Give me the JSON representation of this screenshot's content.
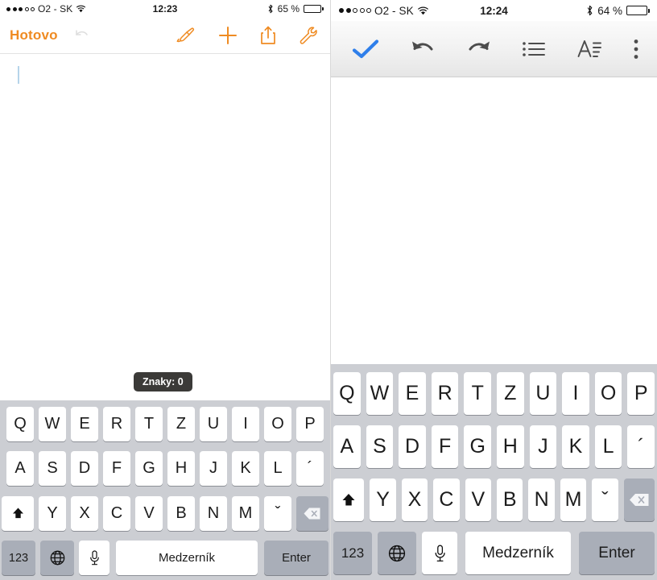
{
  "left": {
    "status": {
      "signal_filled": 3,
      "signal_total": 5,
      "carrier": "O2 - SK",
      "wifi_icon": "wifi-icon",
      "time": "12:23",
      "bluetooth_icon": "bluetooth-icon",
      "battery_text": "65 %",
      "battery_percent": 65
    },
    "toolbar": {
      "done_label": "Hotovo",
      "undo_icon": "undo-icon",
      "undo_disabled": true,
      "icons": [
        "brush-icon",
        "plus-icon",
        "share-icon",
        "wrench-icon"
      ],
      "accent_color": "#ef8b22"
    },
    "note": {
      "body_text": "",
      "caret_visible": true
    },
    "tooltip": {
      "text": "Znaky: 0"
    },
    "keyboard": {
      "row1": [
        "Q",
        "W",
        "E",
        "R",
        "T",
        "Z",
        "U",
        "I",
        "O",
        "P"
      ],
      "row2": [
        "A",
        "S",
        "D",
        "F",
        "G",
        "H",
        "J",
        "K",
        "L",
        "´"
      ],
      "row3": [
        "Y",
        "X",
        "C",
        "V",
        "B",
        "N",
        "M",
        "ˇ"
      ],
      "shift_icon": "shift-icon",
      "backspace_icon": "backspace-icon",
      "numeric_label": "123",
      "globe_icon": "globe-icon",
      "mic_icon": "microphone-icon",
      "space_label": "Medzerník",
      "enter_label": "Enter"
    }
  },
  "right": {
    "status": {
      "signal_filled": 2,
      "signal_total": 5,
      "carrier": "O2 - SK",
      "wifi_icon": "wifi-icon",
      "time": "12:24",
      "bluetooth_icon": "bluetooth-icon",
      "battery_text": "64 %",
      "battery_percent": 64
    },
    "toolbar": {
      "icons": [
        "check-icon",
        "undo-icon",
        "redo-icon",
        "bullet-list-icon",
        "text-format-icon",
        "overflow-menu-icon"
      ],
      "accent_color": "#2f7fea"
    },
    "note": {
      "body_text": ""
    },
    "keyboard": {
      "row1": [
        "Q",
        "W",
        "E",
        "R",
        "T",
        "Z",
        "U",
        "I",
        "O",
        "P"
      ],
      "row2": [
        "A",
        "S",
        "D",
        "F",
        "G",
        "H",
        "J",
        "K",
        "L",
        "´"
      ],
      "row3": [
        "Y",
        "X",
        "C",
        "V",
        "B",
        "N",
        "M",
        "ˇ"
      ],
      "shift_icon": "shift-icon",
      "backspace_icon": "backspace-icon",
      "numeric_label": "123",
      "globe_icon": "globe-icon",
      "mic_icon": "microphone-icon",
      "space_label": "Medzerník",
      "enter_label": "Enter"
    }
  }
}
